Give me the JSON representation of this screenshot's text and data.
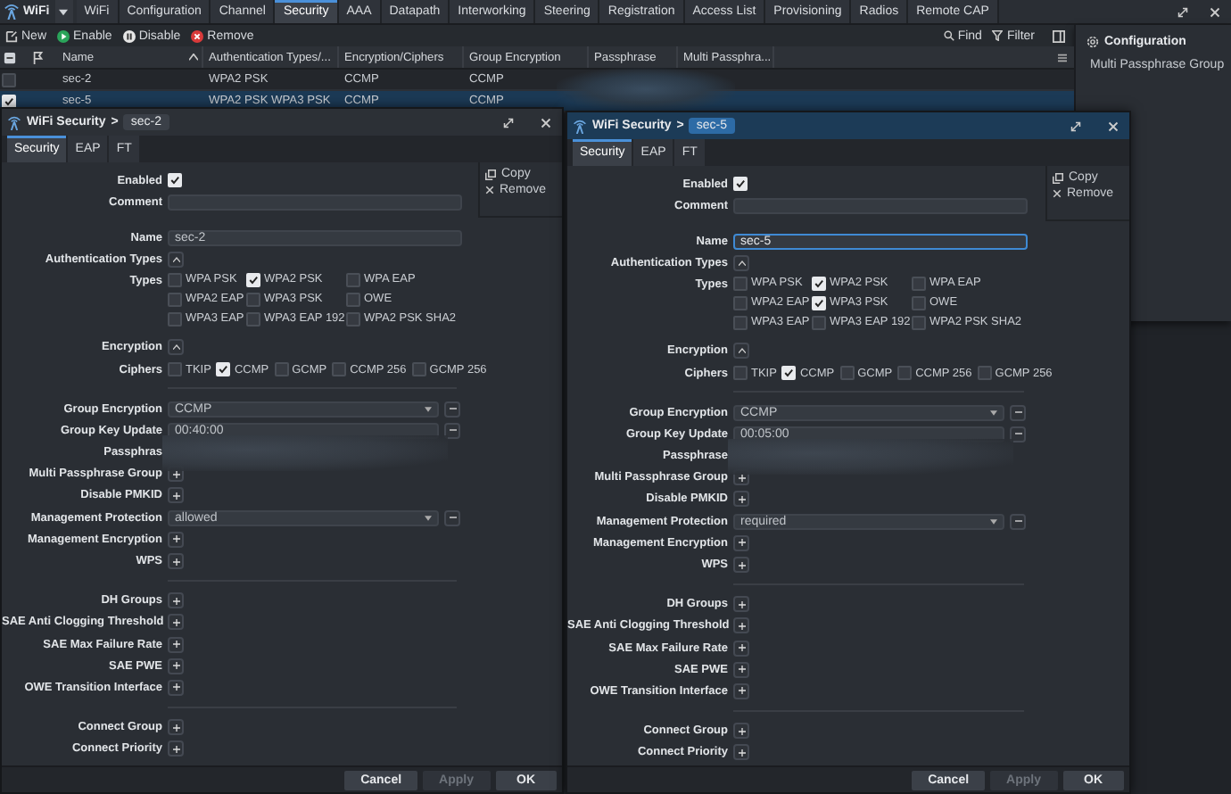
{
  "app": {
    "title": "WiFi",
    "tabs": [
      {
        "label": "WiFi",
        "selected": false
      },
      {
        "label": "Configuration",
        "selected": false
      },
      {
        "label": "Channel",
        "selected": false
      },
      {
        "label": "Security",
        "selected": true
      },
      {
        "label": "AAA",
        "selected": false
      },
      {
        "label": "Datapath",
        "selected": false
      },
      {
        "label": "Interworking",
        "selected": false
      },
      {
        "label": "Steering",
        "selected": false
      },
      {
        "label": "Registration",
        "selected": false
      },
      {
        "label": "Access List",
        "selected": false
      },
      {
        "label": "Provisioning",
        "selected": false
      },
      {
        "label": "Radios",
        "selected": false
      },
      {
        "label": "Remote CAP",
        "selected": false
      }
    ],
    "toolbar": [
      {
        "label": "New",
        "kind": "new"
      },
      {
        "label": "Enable",
        "kind": "enable"
      },
      {
        "label": "Disable",
        "kind": "disable"
      },
      {
        "label": "Remove",
        "kind": "remove"
      }
    ],
    "find": "Find",
    "filter": "Filter",
    "table": {
      "columns": [
        "Name",
        "Authentication Types/...",
        "Encryption/Ciphers",
        "Group Encryption",
        "Passphrase",
        "Multi Passphra..."
      ],
      "rows": [
        {
          "name": "sec-2",
          "auth": "WPA2 PSK",
          "enc": "CCMP",
          "group": "CCMP",
          "checked": false,
          "selected": false
        },
        {
          "name": "sec-5",
          "auth": "WPA2 PSK WPA3 PSK",
          "enc": "CCMP",
          "group": "CCMP",
          "checked": true,
          "selected": true
        }
      ]
    },
    "side_panel": {
      "title": "Configuration",
      "items": [
        "Multi Passphrase Group"
      ]
    }
  },
  "dialogs": [
    {
      "title": "WiFi Security",
      "separator": ">",
      "record": "sec-2",
      "active": false,
      "tabs": [
        {
          "label": "Security",
          "selected": true
        },
        {
          "label": "EAP",
          "selected": false
        },
        {
          "label": "FT",
          "selected": false
        }
      ],
      "enabled": {
        "label": "Enabled",
        "checked": true
      },
      "comment": {
        "label": "Comment"
      },
      "name": {
        "label": "Name",
        "value": "sec-2",
        "focused": false
      },
      "auth": {
        "label": "Authentication Types",
        "expanded": true
      },
      "types": {
        "label": "Types",
        "options": [
          {
            "label": "WPA PSK",
            "checked": false
          },
          {
            "label": "WPA2 PSK",
            "checked": true
          },
          {
            "label": "WPA EAP",
            "checked": false
          },
          {
            "label": "WPA2 EAP",
            "checked": false
          },
          {
            "label": "WPA3 PSK",
            "checked": false
          },
          {
            "label": "OWE",
            "checked": false
          },
          {
            "label": "WPA3 EAP",
            "checked": false
          },
          {
            "label": "WPA3 EAP 192",
            "checked": false
          },
          {
            "label": "WPA2 PSK SHA2",
            "checked": false
          }
        ]
      },
      "encryption": {
        "label": "Encryption",
        "expanded": true
      },
      "ciphers": {
        "label": "Ciphers",
        "options": [
          {
            "label": "TKIP",
            "checked": false
          },
          {
            "label": "CCMP",
            "checked": true
          },
          {
            "label": "GCMP",
            "checked": false
          },
          {
            "label": "CCMP 256",
            "checked": false
          },
          {
            "label": "GCMP 256",
            "checked": false
          }
        ]
      },
      "fields": [
        {
          "kind": "select",
          "label": "Group Encryption",
          "value": "CCMP"
        },
        {
          "kind": "text",
          "label": "Group Key Update",
          "value": "00:40:00"
        },
        {
          "kind": "hidden",
          "label": "Passphras"
        },
        {
          "kind": "plus",
          "label": "Multi Passphrase Group"
        },
        {
          "kind": "plus",
          "label": "Disable PMKID"
        },
        {
          "kind": "select",
          "label": "Management Protection",
          "value": "allowed"
        },
        {
          "kind": "plus",
          "label": "Management Encryption"
        },
        {
          "kind": "plus",
          "label": "WPS"
        },
        {
          "kind": "divider"
        },
        {
          "kind": "plus",
          "label": "DH Groups"
        },
        {
          "kind": "plus",
          "label": "SAE Anti Clogging Threshold"
        },
        {
          "kind": "plus",
          "label": "SAE Max Failure Rate"
        },
        {
          "kind": "plus",
          "label": "SAE PWE"
        },
        {
          "kind": "plus",
          "label": "OWE Transition Interface"
        },
        {
          "kind": "divider"
        },
        {
          "kind": "plus",
          "label": "Connect Group"
        },
        {
          "kind": "plus",
          "label": "Connect Priority"
        }
      ],
      "actions": [
        {
          "label": "Copy",
          "kind": "copy"
        },
        {
          "label": "Remove",
          "kind": "remove"
        }
      ],
      "buttons": [
        {
          "label": "Cancel",
          "disabled": false
        },
        {
          "label": "Apply",
          "disabled": true
        },
        {
          "label": "OK",
          "disabled": false
        }
      ]
    },
    {
      "title": "WiFi Security",
      "separator": ">",
      "record": "sec-5",
      "active": true,
      "tabs": [
        {
          "label": "Security",
          "selected": true
        },
        {
          "label": "EAP",
          "selected": false
        },
        {
          "label": "FT",
          "selected": false
        }
      ],
      "enabled": {
        "label": "Enabled",
        "checked": true
      },
      "comment": {
        "label": "Comment"
      },
      "name": {
        "label": "Name",
        "value": "sec-5",
        "focused": true
      },
      "auth": {
        "label": "Authentication Types",
        "expanded": true
      },
      "types": {
        "label": "Types",
        "options": [
          {
            "label": "WPA PSK",
            "checked": false
          },
          {
            "label": "WPA2 PSK",
            "checked": true
          },
          {
            "label": "WPA EAP",
            "checked": false
          },
          {
            "label": "WPA2 EAP",
            "checked": false
          },
          {
            "label": "WPA3 PSK",
            "checked": true
          },
          {
            "label": "OWE",
            "checked": false
          },
          {
            "label": "WPA3 EAP",
            "checked": false
          },
          {
            "label": "WPA3 EAP 192",
            "checked": false
          },
          {
            "label": "WPA2 PSK SHA2",
            "checked": false
          }
        ]
      },
      "encryption": {
        "label": "Encryption",
        "expanded": true
      },
      "ciphers": {
        "label": "Ciphers",
        "options": [
          {
            "label": "TKIP",
            "checked": false
          },
          {
            "label": "CCMP",
            "checked": true
          },
          {
            "label": "GCMP",
            "checked": false
          },
          {
            "label": "CCMP 256",
            "checked": false
          },
          {
            "label": "GCMP 256",
            "checked": false
          }
        ]
      },
      "fields": [
        {
          "kind": "select",
          "label": "Group Encryption",
          "value": "CCMP"
        },
        {
          "kind": "text",
          "label": "Group Key Update",
          "value": "00:05:00"
        },
        {
          "kind": "hidden",
          "label": "Passphrase"
        },
        {
          "kind": "plus",
          "label": "Multi Passphrase Group"
        },
        {
          "kind": "plus",
          "label": "Disable PMKID"
        },
        {
          "kind": "select",
          "label": "Management Protection",
          "value": "required"
        },
        {
          "kind": "plus",
          "label": "Management Encryption"
        },
        {
          "kind": "plus",
          "label": "WPS"
        },
        {
          "kind": "divider"
        },
        {
          "kind": "plus",
          "label": "DH Groups"
        },
        {
          "kind": "plus",
          "label": "SAE Anti Clogging Threshold"
        },
        {
          "kind": "plus",
          "label": "SAE Max Failure Rate"
        },
        {
          "kind": "plus",
          "label": "SAE PWE"
        },
        {
          "kind": "plus",
          "label": "OWE Transition Interface"
        },
        {
          "kind": "divider"
        },
        {
          "kind": "plus",
          "label": "Connect Group"
        },
        {
          "kind": "plus",
          "label": "Connect Priority"
        }
      ],
      "actions": [
        {
          "label": "Copy",
          "kind": "copy"
        },
        {
          "label": "Remove",
          "kind": "remove"
        }
      ],
      "buttons": [
        {
          "label": "Cancel",
          "disabled": false
        },
        {
          "label": "Apply",
          "disabled": true
        },
        {
          "label": "OK",
          "disabled": false
        }
      ]
    }
  ]
}
